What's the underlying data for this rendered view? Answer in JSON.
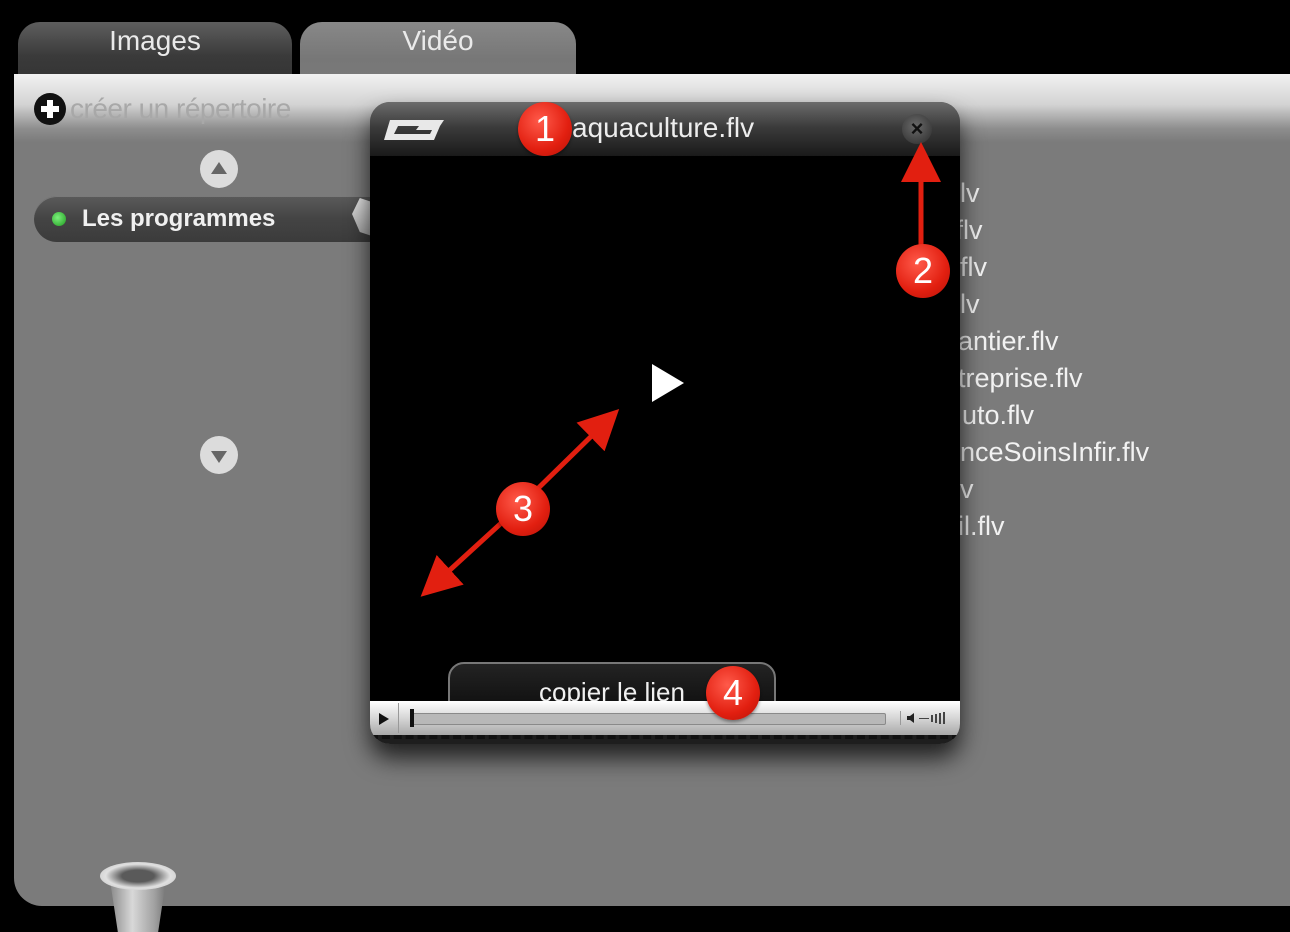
{
  "tabs": [
    {
      "label": "Images"
    },
    {
      "label": "Vidéo"
    }
  ],
  "create_dir": {
    "label": "créer un répertoire"
  },
  "folder": {
    "label": "Les programmes"
  },
  "file_list_fragments": [
    "lv",
    ".flv",
    "flv",
    "lv",
    "antier.flv",
    "treprise.flv",
    "uto.flv",
    "nceSoinsInfir.flv",
    "v",
    "il.flv"
  ],
  "popup": {
    "title": "aquaculture.flv",
    "close_symbol": "×",
    "copy_link_label": "copier le lien"
  },
  "annotations": [
    {
      "number": "1"
    },
    {
      "number": "2"
    },
    {
      "number": "3"
    },
    {
      "number": "4"
    }
  ],
  "icons": {
    "create_dir": "plus-circle-icon",
    "scroll_up": "arrow-up-icon",
    "scroll_down": "arrow-down-icon",
    "brand": "brand-logo-icon",
    "close": "close-icon",
    "play": "play-icon",
    "volume": "volume-icon",
    "trash": "trash-icon"
  },
  "colors": {
    "annotation_red": "#e21f10",
    "folder_dot": "#2fb82f",
    "panel_bg": "#7b7b7b"
  }
}
